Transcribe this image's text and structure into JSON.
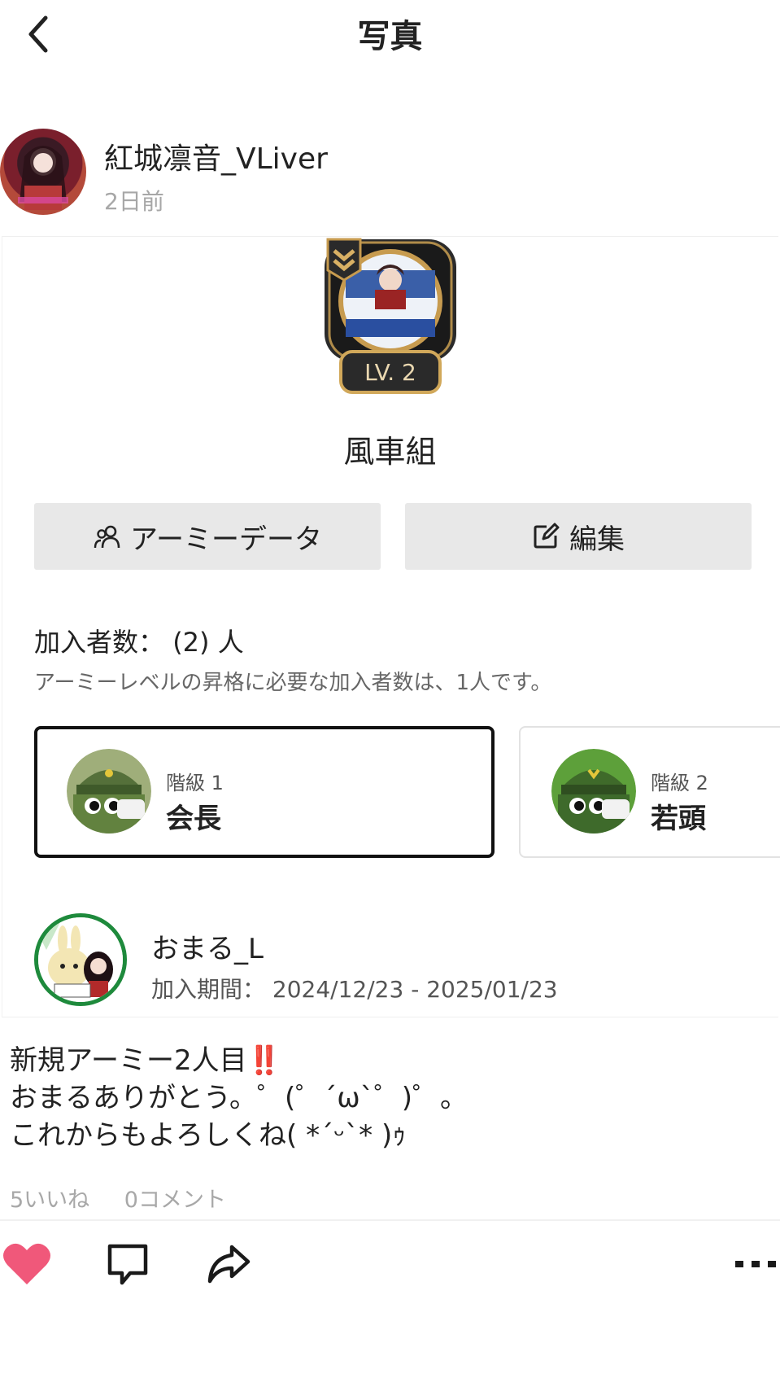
{
  "header": {
    "title": "写真"
  },
  "post": {
    "author": "紅城凛音_VLiver",
    "time": "2日前",
    "caption": "新規アーミー2人目‼️\nおまるありがとう。゜(゜´ω`゜)゜。\nこれからもよろしくね( *´ᵕ`* )ｩ",
    "likes_label": "5いいね",
    "comments_label": "0コメント"
  },
  "army": {
    "badge_level": "LV. 2",
    "name": "風車組",
    "data_button": "アーミーデータ",
    "edit_button": "編集",
    "member_count_label": "加入者数：",
    "member_count_value": "(2) 人",
    "requirement_note": "アーミーレベルの昇格に必要な加入者数は、1人です。",
    "ranks": [
      {
        "level": "階級 1",
        "title": "会長",
        "selected": true
      },
      {
        "level": "階級 2",
        "title": "若頭",
        "selected": false
      }
    ],
    "member": {
      "name": "おまる_L",
      "period_label": "加入期間：",
      "period": "2024/12/23 - 2025/01/23"
    }
  },
  "colors": {
    "like": "#f0587a",
    "rank_green": "#6f8f3f",
    "member_ring": "#1e8a3c",
    "button_bg": "#e8e8e8"
  },
  "icons": {
    "back": "chevron-left-icon",
    "army_data": "users-icon",
    "edit": "edit-icon",
    "like": "heart-icon",
    "comment": "comment-icon",
    "share": "share-icon",
    "more": "more-icon"
  }
}
